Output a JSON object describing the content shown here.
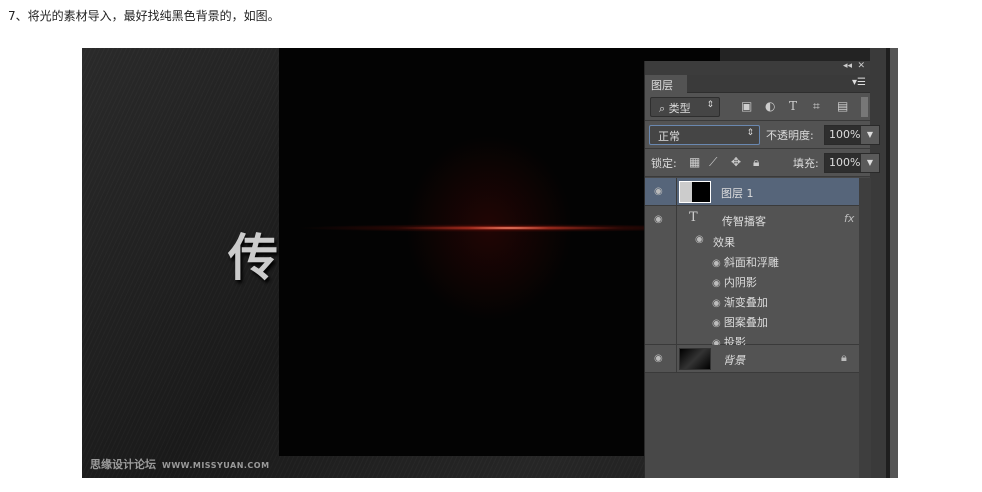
{
  "caption": "7、将光的素材导入，最好找纯黑色背景的，如图。",
  "artwork": {
    "big_char": "传",
    "watermark_cn": "思缘设计论坛",
    "watermark_url": "WWW.MISSYUAN.COM"
  },
  "panel": {
    "tab": "图层",
    "filter": "类型",
    "blend_mode": "正常",
    "opacity_label": "不透明度:",
    "opacity": "100%",
    "lock_label": "锁定:",
    "fill_label": "填充:",
    "fill": "100%",
    "layers": [
      {
        "name": "图层 1",
        "selected": true
      },
      {
        "name": "传智播客",
        "type": "text",
        "fx": "fx",
        "effects_label": "效果",
        "effects": [
          "斜面和浮雕",
          "内阴影",
          "渐变叠加",
          "图案叠加",
          "投影"
        ]
      },
      {
        "name": "背景",
        "locked": true
      }
    ]
  },
  "colors": {
    "selected": "#56657a",
    "panel": "#535353"
  }
}
